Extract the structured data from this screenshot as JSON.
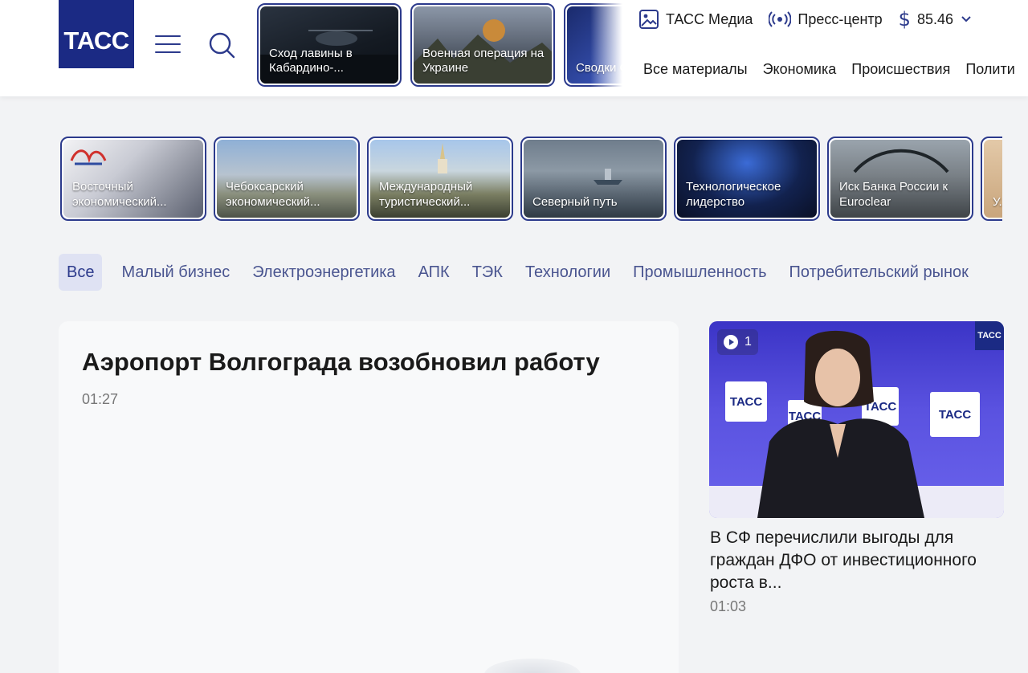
{
  "header": {
    "logo_text": "ТАСС",
    "stories": [
      {
        "label": "Сход лавины в Кабардино-..."
      },
      {
        "label": "Военная операция на Украине"
      },
      {
        "label": "Сводки Совин..."
      }
    ],
    "top_links": [
      {
        "label": "ТАСС Медиа",
        "icon": "image-icon"
      },
      {
        "label": "Пресс-центр",
        "icon": "broadcast-icon"
      }
    ],
    "currency": {
      "symbol": "$",
      "value": "85.46"
    },
    "nav": [
      "Все материалы",
      "Экономика",
      "Происшествия",
      "Полити"
    ]
  },
  "collections": [
    {
      "label": "Восточный экономический..."
    },
    {
      "label": "Чебоксарский экономический..."
    },
    {
      "label": "Международный туристический..."
    },
    {
      "label": "Северный путь"
    },
    {
      "label": "Технологическое лидерство"
    },
    {
      "label": "Иск Банка России к Euroclear"
    },
    {
      "label": "У... р..."
    }
  ],
  "tabs": [
    {
      "label": "Все",
      "active": true
    },
    {
      "label": "Малый бизнес"
    },
    {
      "label": "Электроэнергетика"
    },
    {
      "label": "АПК"
    },
    {
      "label": "ТЭК"
    },
    {
      "label": "Технологии"
    },
    {
      "label": "Промышленность"
    },
    {
      "label": "Потребительский рынок"
    }
  ],
  "main_card": {
    "title": "Аэропорт Волгограда возобновил работу",
    "time": "01:27"
  },
  "side_card": {
    "video_count": "1",
    "logo_text": "ТАСС",
    "title": "В СФ перечислили выгоды для граждан ДФО от инвестиционного роста в...",
    "time": "01:03"
  },
  "colors": {
    "brand": "#1b2a84",
    "accent": "#2c3a8c",
    "tab_active_bg": "#dfe2f3",
    "page_bg": "#f2f3f5"
  }
}
